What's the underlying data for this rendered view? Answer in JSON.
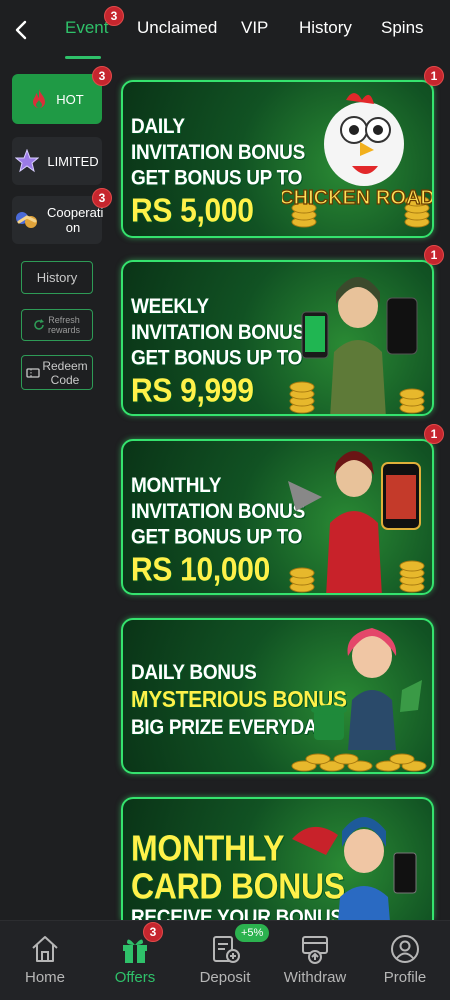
{
  "topbar": {
    "tabs": [
      {
        "label": "Event",
        "badge": "3"
      },
      {
        "label": "Unclaimed"
      },
      {
        "label": "VIP"
      },
      {
        "label": "History"
      },
      {
        "label": "Spins"
      }
    ],
    "active_tab": "Event"
  },
  "sidebar": {
    "categories": [
      {
        "label": "HOT",
        "badge": "3",
        "icon": "fire-icon"
      },
      {
        "label": "LIMITED",
        "icon": "star-icon"
      },
      {
        "label": "Cooperati on",
        "badge": "3",
        "icon": "handshake-icon"
      }
    ],
    "history_label": "History",
    "refresh_label": "Refresh rewards",
    "redeem_label": "Redeem Code"
  },
  "banners": [
    {
      "lines": [
        "DAILY",
        "INVITATION BONUS",
        "GET BONUS UP TO"
      ],
      "amount": "RS 5,000",
      "badge": "1",
      "art_text": "CHICKEN ROAD"
    },
    {
      "lines": [
        "WEEKLY",
        "INVITATION BONUS",
        "GET BONUS UP TO"
      ],
      "amount": "RS 9,999",
      "badge": "1"
    },
    {
      "lines": [
        "MONTHLY",
        "INVITATION BONUS",
        "GET BONUS UP TO"
      ],
      "amount": "RS 10,000",
      "badge": "1"
    },
    {
      "line1": "DAILY BONUS",
      "line2": "MYSTERIOUS BONUS",
      "line3": "BIG PRIZE EVERYDAY"
    },
    {
      "line1": "MONTHLY",
      "line2": "CARD BONUS",
      "line3": "RECEIVE YOUR BONUS"
    }
  ],
  "bottomnav": {
    "items": [
      {
        "label": "Home",
        "icon": "home-icon"
      },
      {
        "label": "Offers",
        "icon": "gift-icon",
        "badge": "3"
      },
      {
        "label": "Deposit",
        "icon": "deposit-icon",
        "pill": "+5%"
      },
      {
        "label": "Withdraw",
        "icon": "withdraw-icon"
      },
      {
        "label": "Profile",
        "icon": "profile-icon"
      }
    ],
    "active": "Offers"
  },
  "colors": {
    "accent": "#2fc16a",
    "badge": "#c6262e",
    "banner_border": "#35e36e",
    "banner_yellow": "#fff14a"
  }
}
